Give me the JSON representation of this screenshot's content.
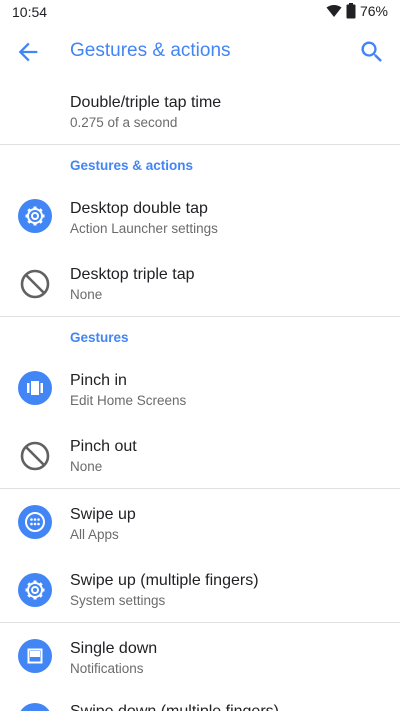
{
  "status": {
    "time": "10:54",
    "battery": "76%",
    "icons": [
      "wifi-icon",
      "battery-icon"
    ]
  },
  "appbar": {
    "title": "Gestures & actions",
    "icons": [
      "back-arrow-icon",
      "search-icon"
    ]
  },
  "top_item": {
    "title": "Double/triple tap time",
    "subtitle": "0.275 of a second"
  },
  "sections": [
    {
      "header": "Gestures & actions",
      "items": [
        {
          "title": "Desktop double tap",
          "subtitle": "Action Launcher settings",
          "icon": "gear-icon"
        },
        {
          "title": "Desktop triple tap",
          "subtitle": "None",
          "icon": "none-icon"
        }
      ]
    },
    {
      "header": "Gestures",
      "items": [
        {
          "title": "Pinch in",
          "subtitle": "Edit Home Screens",
          "icon": "home-screens-icon"
        },
        {
          "title": "Pinch out",
          "subtitle": "None",
          "icon": "none-icon"
        },
        {
          "title": "Swipe up",
          "subtitle": "All Apps",
          "icon": "all-apps-icon"
        },
        {
          "title": "Swipe up (multiple fingers)",
          "subtitle": "System settings",
          "icon": "gear-icon"
        },
        {
          "title": "Single down",
          "subtitle": "Notifications",
          "icon": "notifications-icon"
        },
        {
          "title": "Swipe down (multiple fingers)",
          "subtitle": "",
          "icon": "app-icon"
        }
      ]
    }
  ],
  "colors": {
    "accent": "#4285f4",
    "icon_gray": "#616161",
    "divider": "#e0e0e0"
  }
}
